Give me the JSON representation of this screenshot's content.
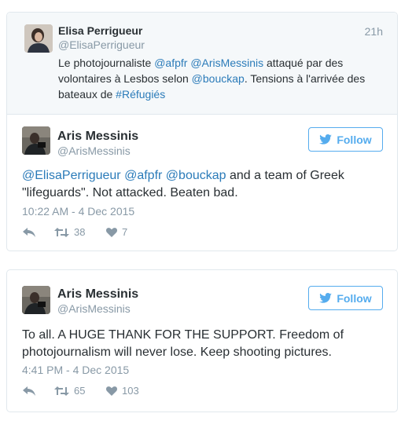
{
  "quoted_tweet": {
    "name": "Elisa Perrigueur",
    "handle": "@ElisaPerrigueur",
    "time": "21h",
    "text_parts": [
      {
        "t": "Le photojournaliste ",
        "link": false
      },
      {
        "t": "@afpfr",
        "link": true
      },
      {
        "t": " ",
        "link": false
      },
      {
        "t": "@ArisMessinis",
        "link": true
      },
      {
        "t": " attaqué par des volontaires à Lesbos selon ",
        "link": false
      },
      {
        "t": "@bouckap",
        "link": true
      },
      {
        "t": ". Tensions à l'arrivée des bateaux de ",
        "link": false
      },
      {
        "t": "#Réfugiés",
        "link": true
      }
    ]
  },
  "reply_tweet": {
    "name": "Aris Messinis",
    "handle": "@ArisMessinis",
    "follow_label": "Follow",
    "text_parts": [
      {
        "t": "@ElisaPerrigueur",
        "link": true
      },
      {
        "t": " ",
        "link": false
      },
      {
        "t": "@afpfr",
        "link": true
      },
      {
        "t": " ",
        "link": false
      },
      {
        "t": "@bouckap",
        "link": true
      },
      {
        "t": " and a team of Greek \"lifeguards\". Not attacked. Beaten bad.",
        "link": false
      }
    ],
    "timestamp": "10:22 AM - 4 Dec 2015",
    "retweets": "38",
    "likes": "7"
  },
  "second_tweet": {
    "name": "Aris Messinis",
    "handle": "@ArisMessinis",
    "follow_label": "Follow",
    "text_parts": [
      {
        "t": "To all. A HUGE THANK FOR THE SUPPORT. Freedom of photojournalism will never lose. Keep shooting pictures.",
        "link": false
      }
    ],
    "timestamp": "4:41 PM - 4 Dec 2015",
    "retweets": "65",
    "likes": "103"
  },
  "icons": {
    "reply": "reply-icon",
    "retweet": "retweet-icon",
    "like": "heart-icon",
    "follow": "bird-icon"
  },
  "colors": {
    "link": "#2b7bb9",
    "follow_accent": "#55acee",
    "muted": "#8899a6",
    "text": "#292f33"
  }
}
